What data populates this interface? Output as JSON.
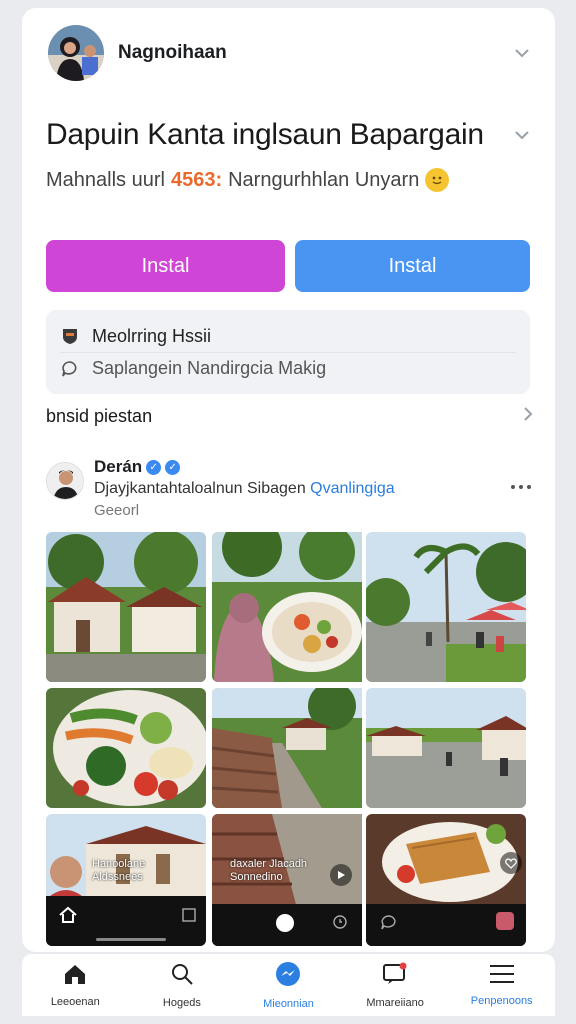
{
  "profile": {
    "name": "Nagnoihaan",
    "avatar_icon": "person-photo-avatar"
  },
  "headline": "Dapuin Kanta inglsaun Bapargain",
  "subline": {
    "before": "Mahnalls uurl",
    "accent": "4563:",
    "after": "Narngurhhlan Unyarn",
    "emoji_icon": "smiling-face-icon"
  },
  "buttons": {
    "left_label": "Instal",
    "right_label": "Instal",
    "left_color": "#cf45d6",
    "right_color": "#4a94f2"
  },
  "info": {
    "line1": "Meolrring Hssii",
    "line1_icon": "badge-icon",
    "line2": "Saplangein Nandirgcia Makig",
    "line2_icon": "chat-bubble-icon"
  },
  "section": {
    "title": "bnsid piestan"
  },
  "post": {
    "author": "Derán",
    "verified_icon": "verified-badge-icon",
    "desc": "Djayjkantahtaloalnun Sibagen",
    "desc_link": "Qvanlingiga",
    "sub": "Geeorl",
    "more_icon": "more-options-icon"
  },
  "tiles": [
    {
      "name": "photo-house-garden",
      "icon": ""
    },
    {
      "name": "photo-woman-food-plate",
      "icon": ""
    },
    {
      "name": "photo-outdoor-market",
      "icon": ""
    },
    {
      "name": "photo-vegetables",
      "icon": ""
    },
    {
      "name": "photo-brick-walkway",
      "icon": ""
    },
    {
      "name": "photo-village-street",
      "icon": ""
    },
    {
      "name": "photo-building-person",
      "overlay_text": "Hanoolane\nAldssnees",
      "icon": "home-icon"
    },
    {
      "name": "video-walkway",
      "overlay_text": "daxaler Jlacadh\nSonnedino",
      "icon": "play-icon"
    },
    {
      "name": "photo-fried-food",
      "icon": "heart-icon"
    }
  ],
  "nav": [
    {
      "label": "Leeoenan",
      "icon": "home-icon"
    },
    {
      "label": "Hogeds",
      "icon": "search-icon"
    },
    {
      "label": "Mieonnian",
      "icon": "messenger-icon"
    },
    {
      "label": "Mmareiiano",
      "icon": "notifications-icon"
    },
    {
      "label": "Penpenoons",
      "icon": "menu-icon"
    }
  ]
}
